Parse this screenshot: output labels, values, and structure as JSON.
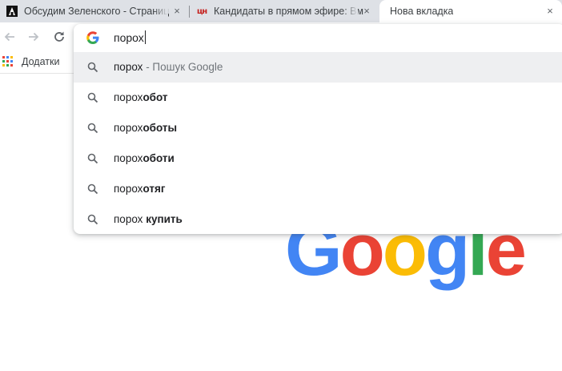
{
  "tabs": [
    {
      "title": "Обсудим Зеленского - Страниц",
      "favicon": "news-site-favicon"
    },
    {
      "title": "Кандидаты в прямом эфире: Вм",
      "favicon_text": "цн"
    },
    {
      "title": "Нова вкладка"
    }
  ],
  "icons": {
    "close": "×",
    "back": "back-arrow-icon",
    "forward": "forward-arrow-icon",
    "reload": "reload-icon",
    "search": "search-icon",
    "google": "google-g-icon",
    "apps": "apps-grid-icon"
  },
  "bookmarks": {
    "apps_label": "Додатки"
  },
  "omnibox": {
    "value": "порох",
    "suggestions": [
      {
        "typed": "порох",
        "completion": "",
        "suffix": " - Пошук Google",
        "selected": true
      },
      {
        "typed": "порох",
        "completion": "обот",
        "suffix": "",
        "selected": false
      },
      {
        "typed": "порох",
        "completion": "оботы",
        "suffix": "",
        "selected": false
      },
      {
        "typed": "порох",
        "completion": "оботи",
        "suffix": "",
        "selected": false
      },
      {
        "typed": "порох",
        "completion": "отяг",
        "suffix": "",
        "selected": false
      },
      {
        "typed": "порох",
        "completion": " купить",
        "suffix": "",
        "selected": false
      }
    ]
  },
  "logo": {
    "letters": [
      "G",
      "o",
      "o",
      "g",
      "l",
      "e"
    ],
    "colors": [
      "#4285f4",
      "#ea4335",
      "#fbbc05",
      "#4285f4",
      "#34a853",
      "#ea4335"
    ]
  },
  "colors": {
    "tabstrip": "#dee1e6",
    "selected_row": "#eeeff1",
    "text": "#202124",
    "subtext": "#70757a"
  }
}
